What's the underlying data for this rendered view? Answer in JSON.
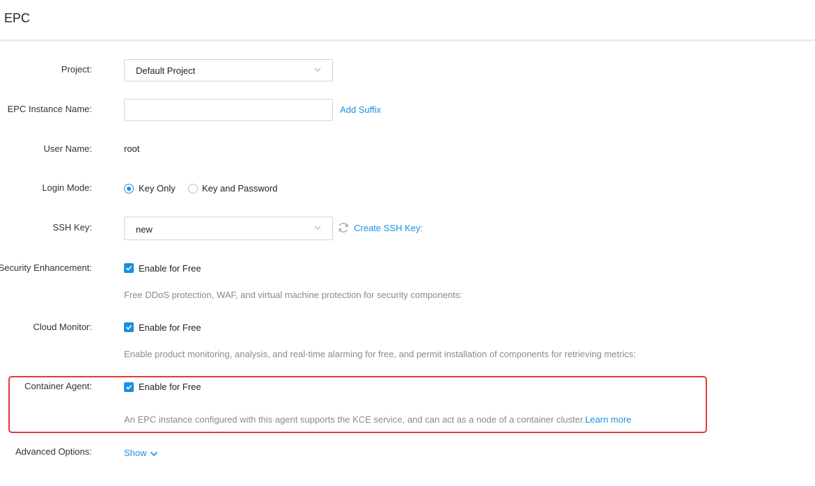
{
  "header": {
    "title": "EPC"
  },
  "project": {
    "label": "Project:",
    "value": "Default Project"
  },
  "instance_name": {
    "label": "EPC Instance Name:",
    "value": "",
    "add_suffix": "Add Suffix"
  },
  "user_name": {
    "label": "User Name:",
    "value": "root"
  },
  "login_mode": {
    "label": "Login Mode:",
    "options": [
      "Key Only",
      "Key and Password"
    ],
    "selected": "Key Only"
  },
  "ssh_key": {
    "label": "SSH Key:",
    "value": "new",
    "create_link": "Create SSH Key:"
  },
  "security": {
    "label": "Security Enhancement:",
    "checkbox": "Enable for Free",
    "checked": true,
    "description": "Free DDoS protection, WAF, and virtual machine protection for security components:"
  },
  "monitor": {
    "label": "Cloud Monitor:",
    "checkbox": "Enable for Free",
    "checked": true,
    "description": "Enable product monitoring, analysis, and real-time alarming for free, and permit installation of components for retrieving metrics:"
  },
  "container_agent": {
    "label": "Container Agent:",
    "checkbox": "Enable for Free",
    "checked": true,
    "description": "An EPC instance configured with this agent supports the KCE service, and can act as a node of a container cluster.",
    "learn_more": "Learn more"
  },
  "advanced": {
    "label": "Advanced Options:",
    "toggle": "Show"
  },
  "colors": {
    "accent": "#1a8fe3",
    "highlight_border": "#e53935"
  }
}
